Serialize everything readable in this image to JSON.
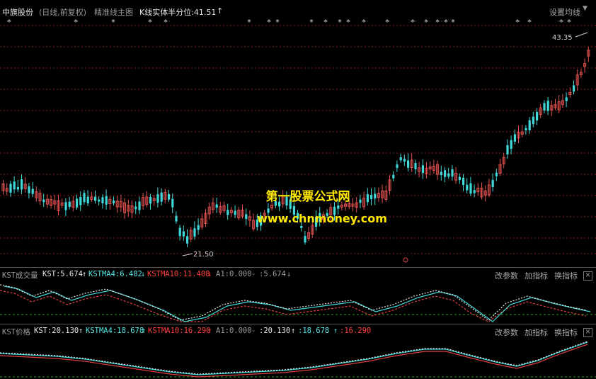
{
  "header": {
    "stock_name": "中旗股份",
    "period": "(日线,前复权)",
    "main_indicator": "精准线主图",
    "kline_label": "K线实体半分位:41.51",
    "kline_arrow": "↑",
    "settings": "设置均线"
  },
  "main_chart": {
    "high_label": "43.35",
    "low_label": "21.50",
    "star_glyph": "*",
    "star_rows": [
      "*",
      "*",
      "**",
      "*",
      "*",
      "*",
      "**",
      "*",
      "**",
      "*",
      "*",
      "**",
      "*",
      "**",
      "*",
      "*",
      "*",
      "***",
      "*",
      "*"
    ]
  },
  "watermark": {
    "line1": "第一股票公式网",
    "line2": "www.chnmoney.com"
  },
  "panel1": {
    "name": "KST成交量",
    "kst": "KST:5.674",
    "kst_arrow": "↑",
    "kstma4": "KSTMA4:6.482",
    "kstma4_arrow": "↓",
    "kstma10": "KSTMA10:11.408",
    "kstma10_arrow": "↓",
    "a1": "A1:0.000",
    "dash": "-",
    "last": ":5.674",
    "last_arrow": "↓",
    "btn_params": "改参数",
    "btn_add": "加指标",
    "btn_switch": "换指标",
    "btn_close": "✕"
  },
  "panel2": {
    "name": "KST价格",
    "kst": "KST:20.130",
    "kst_arrow": "↑",
    "kstma4": "KSTMA4:18.678",
    "kstma4_arrow": "↑",
    "kstma10": "KSTMA10:16.290",
    "kstma10_arrow": "↑",
    "a1": "A1:0.000",
    "dash": "-",
    "v1": ":20.130",
    "v1_arrow": "↑",
    "v2": ":18.678",
    "v2_arrow": "↑",
    "v3": ":16.290",
    "btn_params": "改参数",
    "btn_add": "加指标",
    "btn_switch": "换指标",
    "btn_close": "✕"
  },
  "colors": {
    "up_candle": "#e05050",
    "down_candle": "#40d8d8",
    "kst_line": "#e8e8e8",
    "ma4_line": "#40d8d8",
    "ma10_line": "#e04040",
    "grid": "#8b1a1a"
  }
}
